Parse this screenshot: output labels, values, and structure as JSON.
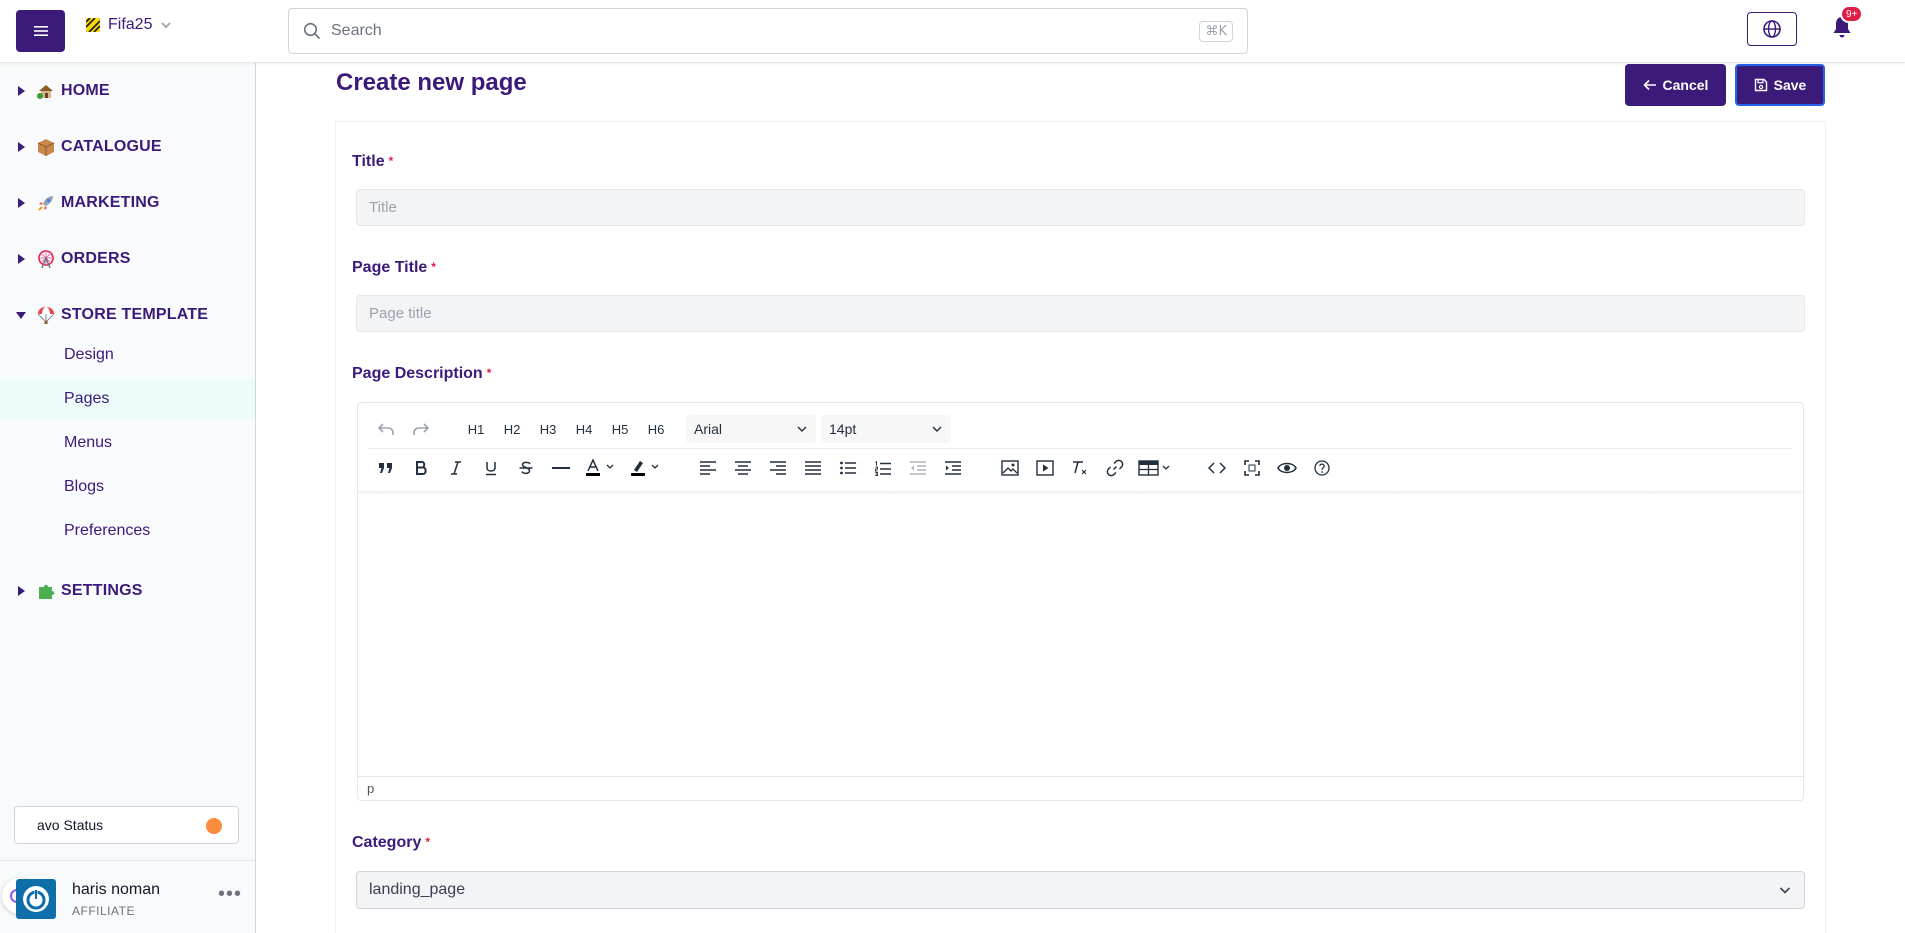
{
  "header": {
    "store_name": "Fifa25",
    "search_placeholder": "Search",
    "search_shortcut": "⌘K",
    "notification_badge": "9+"
  },
  "sidebar": {
    "sections": [
      {
        "label": "HOME",
        "icon": "house-icon",
        "expanded": false
      },
      {
        "label": "CATALOGUE",
        "icon": "package-icon",
        "expanded": false
      },
      {
        "label": "MARKETING",
        "icon": "rocket-icon",
        "expanded": false
      },
      {
        "label": "ORDERS",
        "icon": "ferris-wheel-icon",
        "expanded": false
      },
      {
        "label": "STORE TEMPLATE",
        "icon": "parachute-icon",
        "expanded": true
      },
      {
        "label": "SETTINGS",
        "icon": "puzzle-icon",
        "expanded": false
      }
    ],
    "store_template_items": [
      "Design",
      "Pages",
      "Menus",
      "Blogs",
      "Preferences"
    ],
    "active_item": "Pages",
    "status_label": "avo Status",
    "status_color": "#fb8c3c",
    "user": {
      "name": "haris noman",
      "role": "AFFILIATE"
    }
  },
  "main": {
    "title": "Create new page",
    "cancel_label": "Cancel",
    "save_label": "Save",
    "fields": {
      "title": {
        "label": "Title",
        "placeholder": "Title",
        "value": ""
      },
      "page_title": {
        "label": "Page Title",
        "placeholder": "Page title",
        "value": ""
      },
      "page_description": {
        "label": "Page Description"
      },
      "category": {
        "label": "Category",
        "value": "landing_page"
      }
    },
    "required_mark": "*"
  },
  "editor": {
    "headings": [
      "H1",
      "H2",
      "H3",
      "H4",
      "H5",
      "H6"
    ],
    "font_family": "Arial",
    "font_size": "14pt",
    "status_path": "p"
  },
  "colors": {
    "brand": "#3b1a7a",
    "required": "#e11d48",
    "active_bg": "#ecfdf9"
  }
}
